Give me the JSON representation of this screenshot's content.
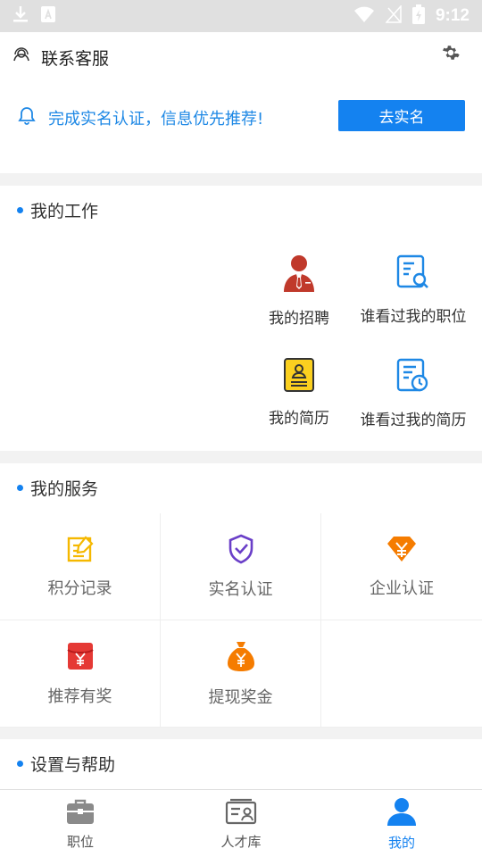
{
  "status_bar": {
    "time": "9:12"
  },
  "header": {
    "contact_label": "联系客服"
  },
  "notice": {
    "text": "完成实名认证，信息优先推荐!",
    "button_label": "去实名"
  },
  "my_work": {
    "title": "我的工作",
    "items": [
      {
        "label": "我的招聘",
        "icon": "recruiter-icon"
      },
      {
        "label": "谁看过我的职位",
        "icon": "document-search-icon"
      },
      {
        "label": "我的简历",
        "icon": "resume-icon"
      },
      {
        "label": "谁看过我的简历",
        "icon": "document-clock-icon"
      }
    ]
  },
  "my_services": {
    "title": "我的服务",
    "items": [
      {
        "label": "积分记录",
        "icon": "edit-note-icon"
      },
      {
        "label": "实名认证",
        "icon": "shield-check-icon"
      },
      {
        "label": "企业认证",
        "icon": "diamond-yen-icon"
      },
      {
        "label": "推荐有奖",
        "icon": "red-envelope-icon"
      },
      {
        "label": "提现奖金",
        "icon": "money-bag-icon"
      }
    ]
  },
  "settings": {
    "title": "设置与帮助"
  },
  "tabbar": {
    "tabs": [
      {
        "label": "职位",
        "icon": "briefcase-icon"
      },
      {
        "label": "人才库",
        "icon": "talent-card-icon"
      },
      {
        "label": "我的",
        "icon": "user-icon",
        "active": true
      }
    ]
  },
  "colors": {
    "accent": "#1482f0",
    "notice_text": "#1e88e5"
  }
}
